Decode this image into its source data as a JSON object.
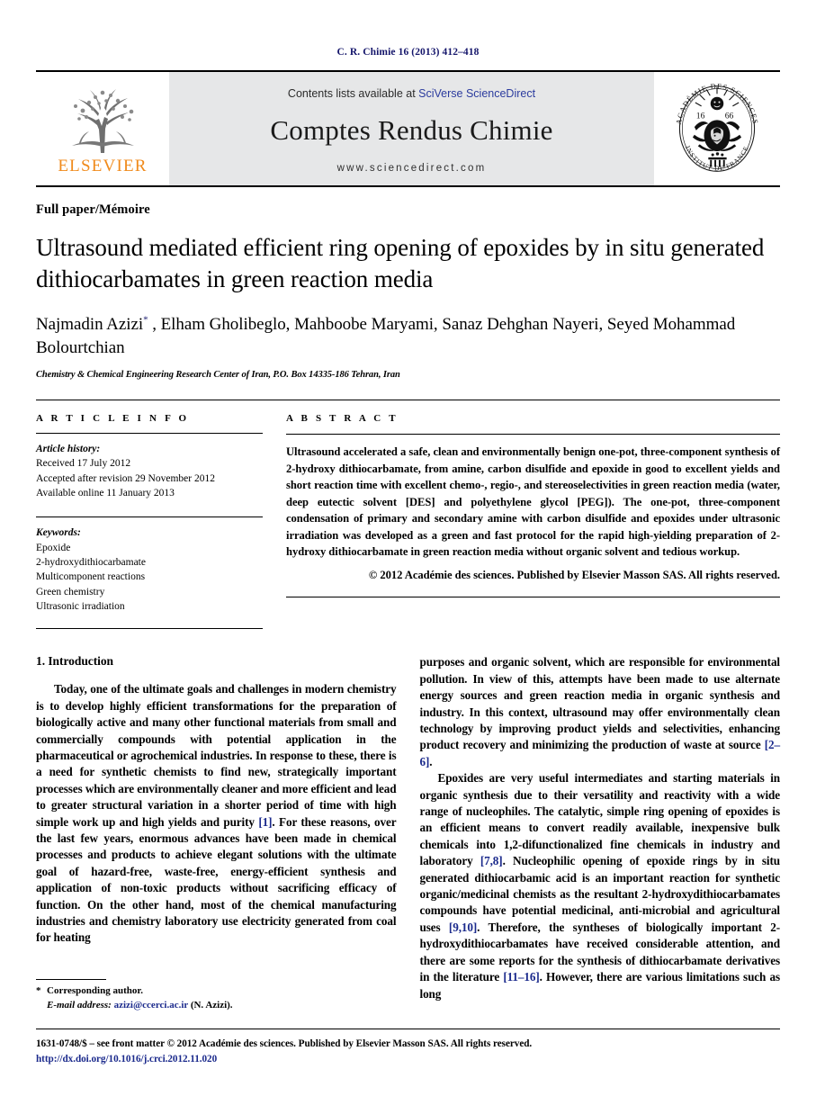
{
  "running_head": "C. R. Chimie 16 (2013) 412–418",
  "masthead": {
    "publisher_logo_name": "ELSEVIER",
    "contents_prefix": "Contents lists available at",
    "contents_link": "SciVerse ScienceDirect",
    "journal_title": "Comptes Rendus Chimie",
    "journal_url": "www.sciencedirect.com",
    "seal_outer_top": "ACADÉMIE DES",
    "seal_outer_bottom": "SCIENCES",
    "seal_outer_left": "INSTITUT DE FRANCE",
    "seal_year": "1666"
  },
  "article": {
    "doctype": "Full paper/Mémoire",
    "title": "Ultrasound mediated efficient ring opening of epoxides by in situ generated dithiocarbamates in green reaction media",
    "authors": "Najmadin Azizi , Elham Gholibeglo, Mahboobe Maryami, Sanaz Dehghan Nayeri, Seyed Mohammad Bolourtchian",
    "corresponding_marker": "*",
    "affiliation": "Chemistry & Chemical Engineering Research Center of Iran, P.O. Box 14335-186 Tehran, Iran"
  },
  "article_info": {
    "heading": "A R T I C L E  I N F O",
    "history_label": "Article history:",
    "history": [
      "Received 17 July 2012",
      "Accepted after revision 29 November 2012",
      "Available online 11 January 2013"
    ],
    "keywords_label": "Keywords:",
    "keywords": [
      "Epoxide",
      "2-hydroxydithiocarbamate",
      "Multicomponent reactions",
      "Green chemistry",
      "Ultrasonic irradiation"
    ]
  },
  "abstract": {
    "heading": "A B S T R A C T",
    "text": "Ultrasound accelerated a safe, clean and environmentally benign one-pot, three-component synthesis of 2-hydroxy dithiocarbamate, from amine, carbon disulfide and epoxide in good to excellent yields and short reaction time with excellent chemo-, regio-, and stereoselectivities in green reaction media (water, deep eutectic solvent [DES] and polyethylene glycol [PEG]). The one-pot, three-component condensation of primary and secondary amine with carbon disulfide and epoxides under ultrasonic irradiation was developed as a green and fast protocol for the rapid high-yielding preparation of 2-hydroxy dithiocarbamate in green reaction media without organic solvent and tedious workup.",
    "copyright": "© 2012 Académie des sciences. Published by Elsevier Masson SAS. All rights reserved."
  },
  "body": {
    "section_heading": "1. Introduction",
    "left_paragraph_1": "Today, one of the ultimate goals and challenges in modern chemistry is to develop highly efficient transformations for the preparation of biologically active and many other functional materials from small and commercially compounds with potential application in the pharmaceutical or agrochemical industries. In response to these, there is a need for synthetic chemists to find new, strategically important processes which are environmentally cleaner and more efficient and lead to greater structural variation in a shorter period of time with high simple work up and high yields and purity ",
    "left_ref_1": "[1]",
    "left_paragraph_1b": ". For these reasons, over the last few years, enormous advances have been made in chemical processes and products to achieve elegant solutions with the ultimate goal of hazard-free, waste-free, energy-efficient synthesis and application of non-toxic products without sacrificing efficacy of function. On the other hand, most of the chemical manufacturing industries and chemistry laboratory use electricity generated from coal for heating",
    "right_paragraph_1": "purposes and organic solvent, which are responsible for environmental pollution. In view of this, attempts have been made to use alternate energy sources and green reaction media in organic synthesis and industry. In this context, ultrasound may offer environmentally clean technology by improving product yields and selectivities, enhancing product recovery and minimizing the production of waste at source ",
    "right_ref_1": "[2–6]",
    "right_paragraph_1b": ".",
    "right_paragraph_2": "Epoxides are very useful intermediates and starting materials in organic synthesis due to their versatility and reactivity with a wide range of nucleophiles. The catalytic, simple ring opening of epoxides is an efficient means to convert readily available, inexpensive bulk chemicals into 1,2-difunctionalized fine chemicals in industry and laboratory ",
    "right_ref_2": "[7,8]",
    "right_paragraph_2b": ". Nucleophilic opening of epoxide rings by in situ generated dithiocarbamic acid is an important reaction for synthetic organic/medicinal chemists as the resultant 2-hydroxydithiocarbamates compounds have potential medicinal, anti-microbial and agricultural uses ",
    "right_ref_3": "[9,10]",
    "right_paragraph_2c": ". Therefore, the syntheses of biologically important 2-hydroxydithiocarbamates have received considerable attention, and there are some reports for the synthesis of dithiocarbamate derivatives in the literature ",
    "right_ref_4": "[11–16]",
    "right_paragraph_2d": ". However, there are various limitations such as long"
  },
  "footnote": {
    "star": "*",
    "corresponding": "Corresponding author.",
    "email_label": "E-mail address:",
    "email": "azizi@ccerci.ac.ir",
    "email_suffix": "(N. Azizi)."
  },
  "footer": {
    "front_matter": "1631-0748/$ – see front matter © 2012 Académie des sciences. Published by Elsevier Masson SAS. All rights reserved.",
    "doi": "http://dx.doi.org/10.1016/j.crci.2012.11.020"
  },
  "colors": {
    "link_blue": "#1b2a8c",
    "running_head_blue": "#15166b",
    "elsevier_orange": "#f08a1b",
    "masthead_grey": "#e6e7e8"
  }
}
